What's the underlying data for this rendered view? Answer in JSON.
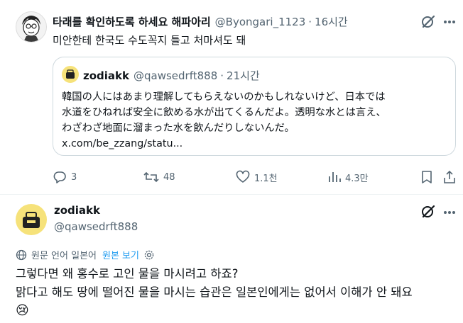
{
  "reply": {
    "author_name": "타래를 확인하도록 하세요 해파아리",
    "handle": "@Byongari_1123",
    "separator": "·",
    "time": "16시간",
    "text": "미안한테 한국도 수도꼭지 틀고 처마셔도 돼"
  },
  "quoted": {
    "author_name": "zodiakk",
    "handle": "@qawsedrft888",
    "separator": "·",
    "time": "21시간",
    "line1": "韓国の人にはあまり理解してもらえないのかもしれないけど、日本では",
    "line2": "水道をひねれば安全に飲める水が出てくるんだよ。透明な水とは言え、",
    "line3": "わざわざ地面に溜まった水を飲んだりしないんだ。",
    "link": "x.com/be_zzang/statu..."
  },
  "actions": {
    "replies": "3",
    "reposts": "48",
    "likes": "1.1천",
    "views": "4.3만"
  },
  "main_post": {
    "author_name": "zodiakk",
    "handle": "@qawsedrft888",
    "translation_note": "원문 언어 일본어",
    "view_original": "원본 보기",
    "line1": "그렇다면 왜 홍수로 고인 물을 마시려고 하죠?",
    "line2": "맑다고 해도 땅에 떨어진 물을 마시는 습관은 일본인에게는 없어서 이해가 안 돼요",
    "emoji": "😢"
  },
  "colors": {
    "text": "#0f1419",
    "muted": "#536471",
    "link_blue": "#1d9bf0",
    "border": "#cfd9de"
  }
}
